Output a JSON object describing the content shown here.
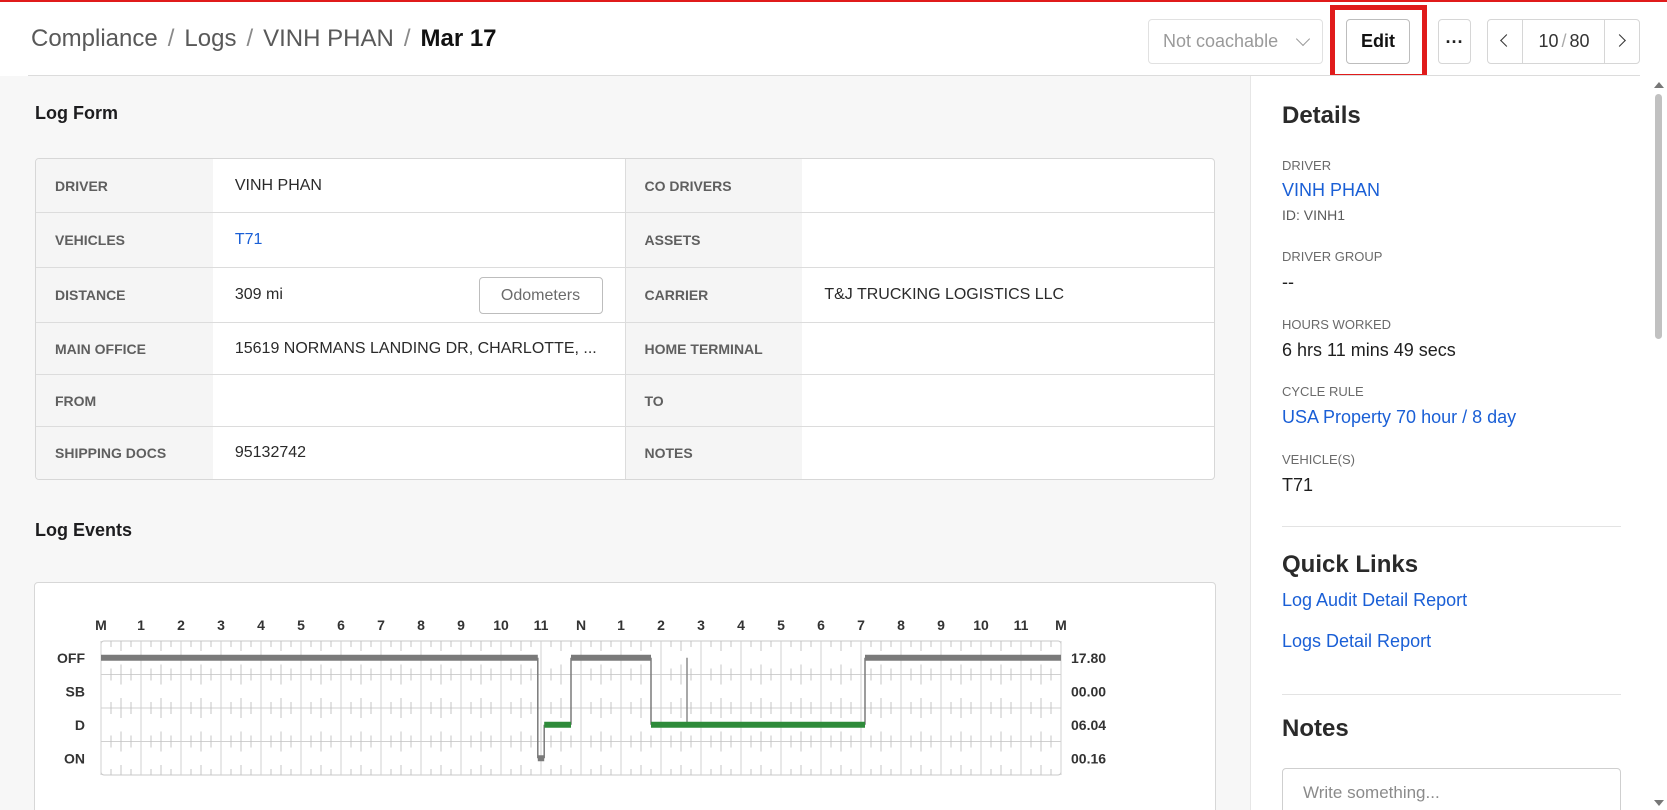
{
  "breadcrumb": {
    "items": [
      "Compliance",
      "Logs",
      "VINH PHAN"
    ],
    "current": "Mar 17",
    "separator": "/"
  },
  "toolbar": {
    "coach_select": "Not coachable",
    "edit_label": "Edit",
    "more_label": "···",
    "pager": {
      "current": "10",
      "separator": "/",
      "total": "80"
    }
  },
  "log_form": {
    "title": "Log Form",
    "rows": [
      [
        {
          "label": "DRIVER",
          "value": "VINH PHAN"
        },
        {
          "label": "CO DRIVERS",
          "value": ""
        }
      ],
      [
        {
          "label": "VEHICLES",
          "value": "T71"
        },
        {
          "label": "ASSETS",
          "value": ""
        }
      ],
      [
        {
          "label": "DISTANCE",
          "value": "309 mi"
        },
        {
          "label": "CARRIER",
          "value": "T&J TRUCKING LOGISTICS LLC"
        }
      ],
      [
        {
          "label": "MAIN OFFICE",
          "value": "15619 NORMANS LANDING DR, CHARLOTTE, ..."
        },
        {
          "label": "HOME TERMINAL",
          "value": ""
        }
      ],
      [
        {
          "label": "FROM",
          "value": ""
        },
        {
          "label": "TO",
          "value": ""
        }
      ],
      [
        {
          "label": "SHIPPING DOCS",
          "value": "95132742"
        },
        {
          "label": "NOTES",
          "value": ""
        }
      ]
    ],
    "odometers_label": "Odometers"
  },
  "log_events": {
    "title": "Log Events"
  },
  "chart_data": {
    "type": "line",
    "title": "",
    "x_ticks": [
      "M",
      "1",
      "2",
      "3",
      "4",
      "5",
      "6",
      "7",
      "8",
      "9",
      "10",
      "11",
      "N",
      "1",
      "2",
      "3",
      "4",
      "5",
      "6",
      "7",
      "8",
      "9",
      "10",
      "11",
      "M"
    ],
    "xlim": [
      0,
      24
    ],
    "statuses": [
      "OFF",
      "SB",
      "D",
      "ON"
    ],
    "totals": [
      "17.80",
      "00.00",
      "06.04",
      "00.16"
    ],
    "segments": [
      {
        "status": "OFF",
        "start": 0.0,
        "end": 10.92
      },
      {
        "status": "ON",
        "start": 10.92,
        "end": 11.08
      },
      {
        "status": "D",
        "start": 11.08,
        "end": 11.75
      },
      {
        "status": "OFF",
        "start": 11.75,
        "end": 13.75
      },
      {
        "status": "D",
        "start": 13.75,
        "end": 19.1
      },
      {
        "status": "OFF",
        "start": 19.1,
        "end": 24.0
      }
    ],
    "marker_times": [
      14.65
    ],
    "colors": {
      "off": "#7a7a7a",
      "driving": "#2e8b3a",
      "on": "#7a7a7a",
      "grid": "#d0d0d0"
    }
  },
  "details": {
    "title": "Details",
    "driver_label": "DRIVER",
    "driver_name": "VINH PHAN",
    "driver_id": "ID: VINH1",
    "group_label": "DRIVER GROUP",
    "group_value": "--",
    "hours_label": "HOURS WORKED",
    "hours_value": "6 hrs 11 mins 49 secs",
    "cycle_label": "CYCLE RULE",
    "cycle_value": "USA Property 70 hour / 8 day",
    "vehicles_label": "VEHICLE(S)",
    "vehicles_value": "T71"
  },
  "quick_links": {
    "title": "Quick Links",
    "items": [
      "Log Audit Detail Report",
      "Logs Detail Report"
    ]
  },
  "notes": {
    "title": "Notes",
    "placeholder": "Write something..."
  }
}
